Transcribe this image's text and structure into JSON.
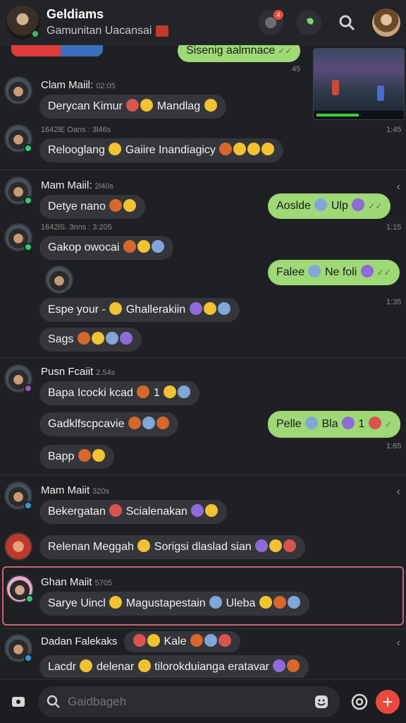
{
  "header": {
    "title": "Geldiams",
    "subtitle": "Gamunitan Uacansai",
    "badge_count": "4"
  },
  "top_fragment": {
    "green_text": "Sisenig aalmnace",
    "time": "45"
  },
  "messages": [
    {
      "name": "Clam Maiil:",
      "time": "02:05",
      "bubbles": [
        "Derycan Kimur",
        "Mandlag"
      ]
    },
    {
      "meta": "1642lE Oans : 3l46s",
      "bubbles": [
        "Relooglang",
        "Gaiire Inandiagicy"
      ],
      "time_right": "1:45"
    },
    {
      "name": "Mam Maiil:",
      "time": "2l40s",
      "bubbles": [
        "Detye nano"
      ]
    },
    {
      "meta": "1642lS. 3nns : 3:205",
      "bubbles": [
        "Gakop owocai",
        "Espe your -",
        "Ghallerakiin",
        "Sags"
      ]
    },
    {
      "name": "Pusn Fcaiit",
      "time": "2.54s",
      "bubbles": [
        "Bapa Icocki kcad",
        "1",
        "Gadklfscpcavie",
        "Bapp"
      ]
    },
    {
      "name": "Mam Maiit",
      "time": "320s",
      "bubbles": [
        "Bekergatan",
        "Scialenakan",
        "Relenan Meggah",
        "Sorigsi dlaslad sian"
      ]
    },
    {
      "name": "Ghan Maiit",
      "time": "5705",
      "bubbles": [
        "Sarye Uincl",
        "Magustapestain",
        "Uleba"
      ]
    },
    {
      "name": "Dadan Falekaks",
      "bubbles": [
        "Kale",
        "Lacdr",
        "delenar",
        "tilorokduianga eratavar"
      ]
    }
  ],
  "outgoing": [
    {
      "text_a": "Aoslde",
      "text_b": "Ulp",
      "time": "1:15"
    },
    {
      "text_a": "Falee",
      "text_b": "Ne foli",
      "time": "1:35"
    },
    {
      "text_a": "Pelle",
      "text_b": "Bla",
      "count": "1",
      "time": "1:65"
    }
  ],
  "composer": {
    "placeholder": "Gaidbageh"
  },
  "colors": {
    "background": "#1f2023",
    "incoming_bubble": "#35363b",
    "outgoing_bubble": "#9fd877",
    "accent_red": "#e94a3f",
    "highlight_border": "#c9637a"
  }
}
